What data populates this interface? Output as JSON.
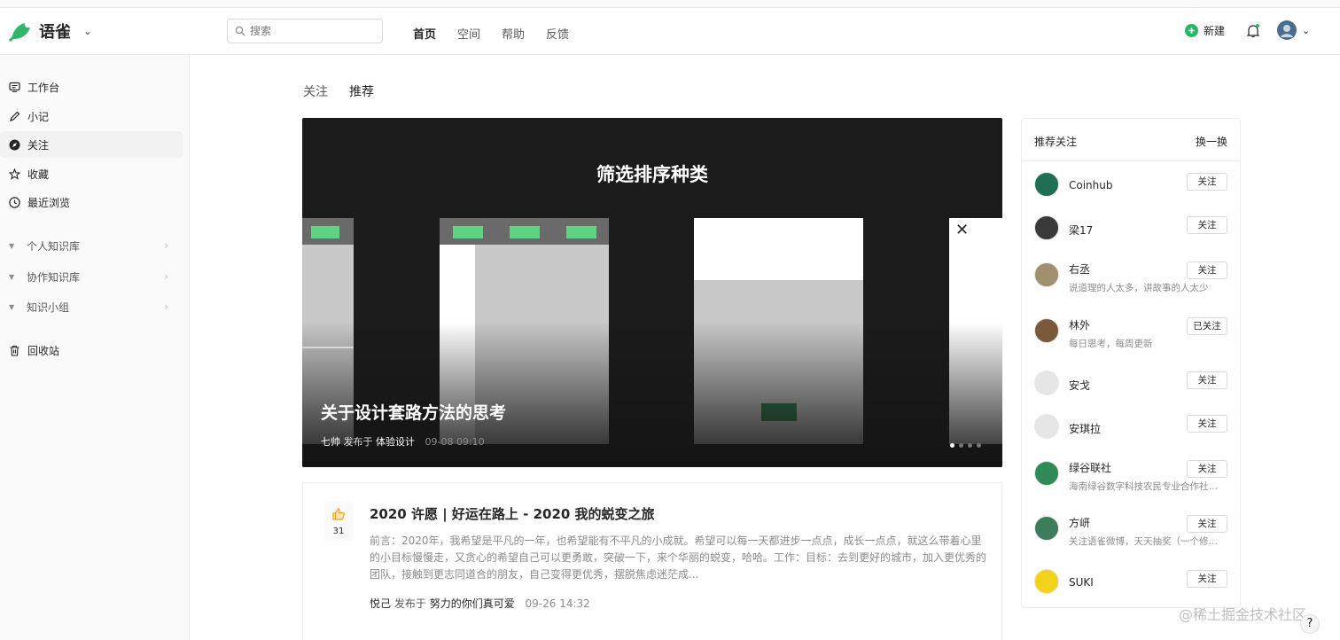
{
  "header": {
    "app_name": "语雀",
    "search_placeholder": "搜索",
    "nav": [
      "首页",
      "空间",
      "帮助",
      "反馈"
    ],
    "new_label": "新建"
  },
  "sidebar": {
    "items": [
      {
        "label": "工作台",
        "icon": "workbench-icon"
      },
      {
        "label": "小记",
        "icon": "pen-icon"
      },
      {
        "label": "关注",
        "icon": "compass-icon"
      },
      {
        "label": "收藏",
        "icon": "star-icon"
      },
      {
        "label": "最近浏览",
        "icon": "clock-icon"
      }
    ],
    "groups": [
      "个人知识库",
      "协作知识库",
      "知识小组"
    ],
    "trash": "回收站"
  },
  "tabs": [
    "关注",
    "推荐"
  ],
  "banner": {
    "title": "筛选排序种类",
    "headline": "关于设计套路方法的思考",
    "author": "七帅",
    "published_in": "发布于",
    "book": "体验设计",
    "time": "09-08 09:10"
  },
  "post": {
    "likes": "31",
    "title": "2020 许愿 | 好运在路上 - 2020 我的蜕变之旅",
    "body": "前言：2020年，我希望是平凡的一年，也希望能有不平凡的小成就。希望可以每一天都进步一点点，成长一点点，就这么带着心里的小目标慢慢走，又贪心的希望自己可以更勇敢，突破一下，来个华丽的蜕变，哈哈。工作：目标：去到更好的城市，加入更优秀的团队，接触到更志同道合的朋友，自己变得更优秀，摆脱焦虑迷茫成...",
    "author": "悦己",
    "published_in": "发布于",
    "book": "努力的你们真可爱",
    "time": "09-26 14:32"
  },
  "recommend": {
    "title": "推荐关注",
    "change": "换一换",
    "users": [
      {
        "name": "Coinhub",
        "desc": "",
        "follow": "关注",
        "color": "#1f6f55"
      },
      {
        "name": "梁17",
        "desc": "",
        "follow": "关注",
        "color": "#3a3a3a"
      },
      {
        "name": "右丞",
        "desc": "说道理的人太多，讲故事的人太少",
        "follow": "关注",
        "color": "#a09070"
      },
      {
        "name": "林外",
        "desc": "每日思考，每周更新",
        "follow": "已关注",
        "color": "#7a5a3a"
      },
      {
        "name": "安戈",
        "desc": "",
        "follow": "关注",
        "color": "#e6e6e6"
      },
      {
        "name": "安琪拉",
        "desc": "",
        "follow": "关注",
        "color": "#e6e6e6"
      },
      {
        "name": "绿谷联社",
        "desc": "海南绿谷数字科技农民专业合作社联...",
        "follow": "关注",
        "color": "#2e8b57"
      },
      {
        "name": "方岍",
        "desc": "关注语雀微博，天天抽奖（一个修辞...",
        "follow": "关注",
        "color": "#3d7d5d"
      },
      {
        "name": "SUKI",
        "desc": "",
        "follow": "关注",
        "color": "#f2d21a"
      }
    ]
  },
  "watermark": "@稀土掘金技术社区",
  "help": "?"
}
